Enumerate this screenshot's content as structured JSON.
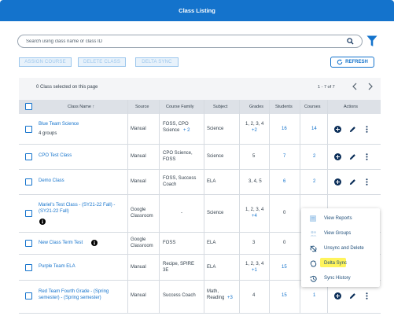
{
  "header": {
    "title": "Class Listing"
  },
  "search": {
    "placeholder": "Search using class name or class ID"
  },
  "toolbar": {
    "assign_course": "ASSIGN COURSE",
    "delete_class": "DELETE CLASS",
    "delta_sync": "DELTA SYNC",
    "refresh": "REFRESH"
  },
  "table": {
    "selection_text": "0 Class selected on this page",
    "pagination": "1 - 7 of 7",
    "columns": {
      "class_name": "Class Name ↑",
      "source": "Source",
      "course_family": "Course Family",
      "subject": "Subject",
      "grades": "Grades",
      "students": "Students",
      "courses": "Courses",
      "actions": "Actions"
    },
    "rows": [
      {
        "name": "Blue Team Science",
        "sub": "4 groups",
        "source": "Manual",
        "family": "FOSS, CPO",
        "family2": "Science",
        "family_more": "+ 2",
        "subject": "Science",
        "grades": "1, 2, 3, 4",
        "grades_more": "+2",
        "students": "16",
        "courses": "14"
      },
      {
        "name": "CPO Test Class",
        "source": "Manual",
        "family": "CPO Science,",
        "family2": "FOSS",
        "subject": "Science",
        "grades": "5",
        "students": "7",
        "courses": "2"
      },
      {
        "name": "Demo Class",
        "source": "Manual",
        "family": "FOSS, Success",
        "family2": "Coach",
        "subject": "ELA",
        "grades": "3, 4, 5",
        "students": "6",
        "courses": "2"
      },
      {
        "name": "Mariel's Test Class - (SY21-22 Fall) -",
        "name2": "(SY21-22 Fall)",
        "source": "Google",
        "source2": "Classroom",
        "family": "-",
        "subject": "Science",
        "grades": "1, 2, 3, 4",
        "grades_more": "+4",
        "students": "0"
      },
      {
        "name": "New Class Term Test",
        "source": "Google",
        "source2": "Classroom",
        "family": "FOSS",
        "subject": "ELA",
        "grades": "3",
        "students": "0"
      },
      {
        "name": "Purple Team ELA",
        "source": "Manual",
        "family": "Recipe, SPIRE",
        "family2": "3E",
        "subject": "ELA",
        "grades": "1, 2, 3, 4",
        "grades_more": "+1",
        "students": "15"
      },
      {
        "name": "Red Team Fourth Grade - (Spring",
        "name2": "semester) - (Spring semester)",
        "source": "Manual",
        "family": "Success Coach",
        "subject": "Math,",
        "subject2": "Reading",
        "subject_more": "+3",
        "grades": "4",
        "students": "15",
        "courses": "1"
      }
    ]
  },
  "menu": {
    "items": [
      "View Reports",
      "View Groups",
      "Unsync and Delete",
      "Delta Sync",
      "Sync History"
    ]
  },
  "colors": {
    "brand": "#1473cc",
    "highlight": "#fff45c",
    "dark": "#0b2e59"
  }
}
